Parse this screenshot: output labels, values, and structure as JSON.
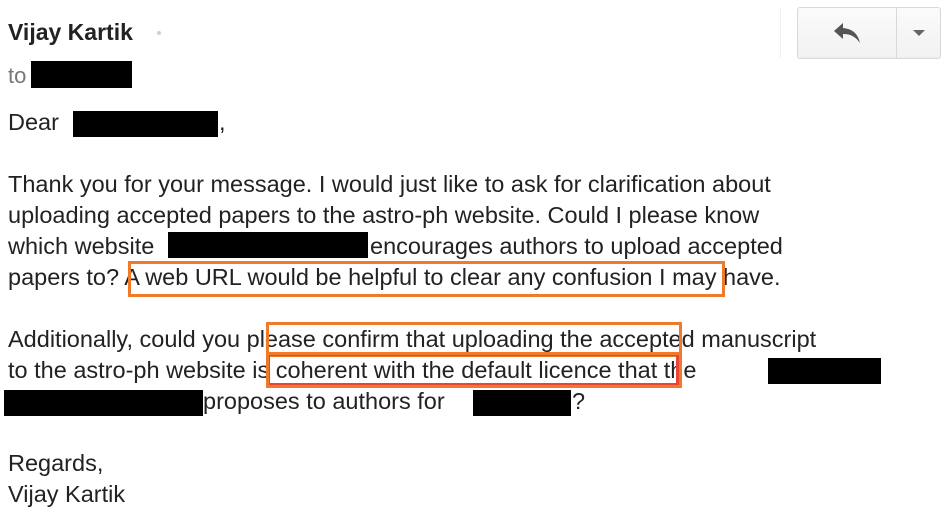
{
  "header": {
    "sender_name": "Vijay Kartik",
    "to_label": "to"
  },
  "toolbar": {
    "reply_icon": "reply-arrow-icon",
    "more_icon": "chevron-down-icon"
  },
  "body": {
    "greeting": "Dear",
    "greeting_comma": ",",
    "p1_l1": "Thank you for your message. I would just like to ask for clarification about",
    "p1_l2": "uploading accepted papers to the astro-ph website. Could I please know",
    "p1_l3a": "which website",
    "p1_l3b": "encourages authors to upload accepted",
    "p1_l4": "papers to? A web URL would be helpful to clear any confusion I may have.",
    "p2_l1": "Additionally, could you please confirm that uploading the accepted manuscript",
    "p2_l2a": "to the astro-ph website is coherent with the default licence that the",
    "p2_l3a": "proposes to authors for",
    "p2_l3b": "?",
    "closing": "Regards,",
    "signature": "Vijay Kartik"
  },
  "colors": {
    "highlight_orange": "#f07a2a",
    "highlight_red": "#e8443a",
    "redaction": "#000000"
  }
}
